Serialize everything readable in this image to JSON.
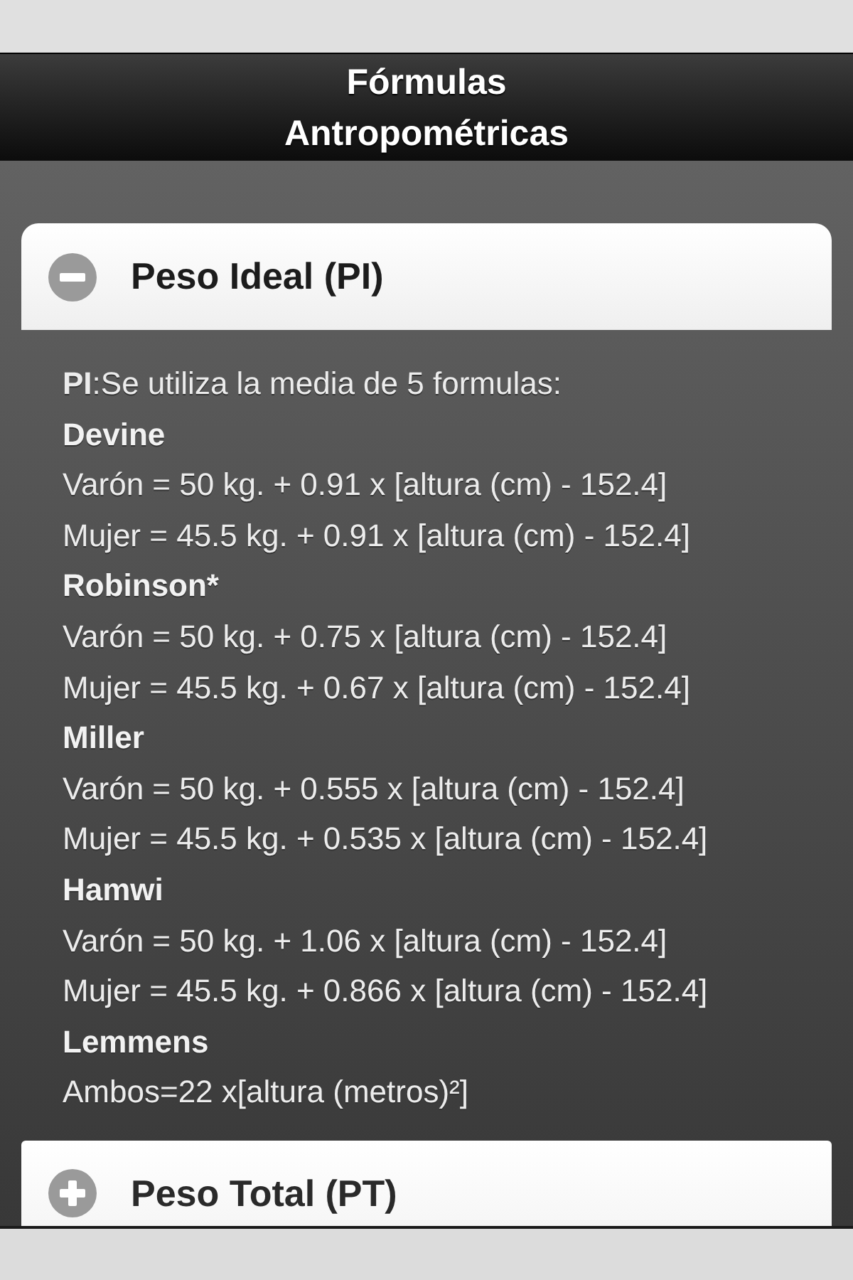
{
  "header": {
    "title": "Fórmulas Antropométricas"
  },
  "sections": [
    {
      "title": "Peso Ideal (PI)",
      "expanded": true,
      "content": [
        {
          "kind": "intro",
          "text": "**PI**:Se utiliza la media de 5 formulas:"
        },
        {
          "kind": "heading",
          "text": "Devine"
        },
        {
          "kind": "line",
          "text": "Varón = 50 kg. + 0.91 x [altura (cm) - 152.4]"
        },
        {
          "kind": "line",
          "text": "Mujer = 45.5 kg. + 0.91 x [altura (cm) - 152.4]"
        },
        {
          "kind": "heading",
          "text": "Robinson*"
        },
        {
          "kind": "line",
          "text": "Varón = 50 kg. + 0.75 x [altura (cm) - 152.4]"
        },
        {
          "kind": "line",
          "text": "Mujer = 45.5 kg. + 0.67 x [altura (cm) - 152.4]"
        },
        {
          "kind": "heading",
          "text": "Miller"
        },
        {
          "kind": "line",
          "text": "Varón = 50 kg. + 0.555 x [altura (cm) - 152.4]"
        },
        {
          "kind": "line",
          "text": "Mujer = 45.5 kg. + 0.535 x [altura (cm) - 152.4]"
        },
        {
          "kind": "heading",
          "text": "Hamwi"
        },
        {
          "kind": "line",
          "text": "Varón = 50 kg. + 1.06 x [altura (cm) - 152.4]"
        },
        {
          "kind": "line",
          "text": "Mujer = 45.5 kg. + 0.866 x [altura (cm) - 152.4]"
        },
        {
          "kind": "heading",
          "text": "Lemmens"
        },
        {
          "kind": "line",
          "text": "Ambos=22 x[altura (metros)²]"
        }
      ]
    },
    {
      "title": "Peso Total (PT)",
      "expanded": false
    }
  ]
}
